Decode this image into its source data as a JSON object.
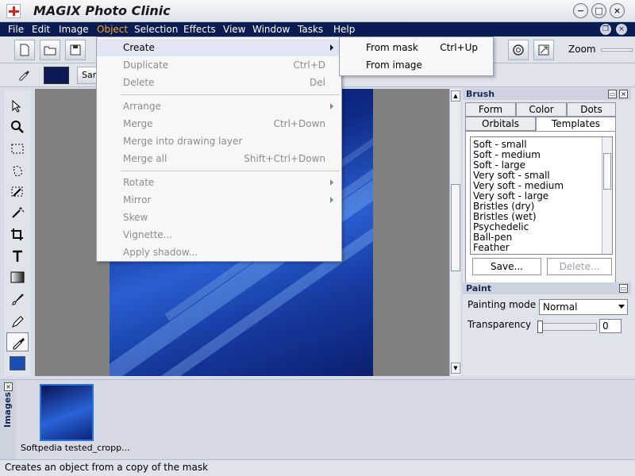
{
  "window": {
    "title": "MAGIX Photo Clinic",
    "min": "−",
    "max": "□",
    "close": "×"
  },
  "menubar": {
    "items": [
      "File",
      "Edit",
      "Image",
      "Object",
      "Selection",
      "Effects",
      "View",
      "Window",
      "Tasks",
      "Help"
    ],
    "active": "Object"
  },
  "toolbar": {
    "zoom_label": "Zoom",
    "sample_label": "Sam",
    "color": "#0d1a55"
  },
  "object_menu": {
    "items": [
      {
        "label": "Create",
        "shortcut": "",
        "submenu": true,
        "enabled": true
      },
      {
        "label": "Duplicate",
        "shortcut": "Ctrl+D",
        "submenu": false,
        "enabled": false
      },
      {
        "label": "Delete",
        "shortcut": "Del",
        "submenu": false,
        "enabled": false
      },
      {
        "label": "Arrange",
        "shortcut": "",
        "submenu": true,
        "enabled": false
      },
      {
        "label": "Merge",
        "shortcut": "Ctrl+Down",
        "submenu": false,
        "enabled": false
      },
      {
        "label": "Merge into drawing layer",
        "shortcut": "",
        "submenu": false,
        "enabled": false
      },
      {
        "label": "Merge all",
        "shortcut": "Shift+Ctrl+Down",
        "submenu": false,
        "enabled": false
      },
      {
        "label": "Rotate",
        "shortcut": "",
        "submenu": true,
        "enabled": false
      },
      {
        "label": "Mirror",
        "shortcut": "",
        "submenu": true,
        "enabled": false
      },
      {
        "label": "Skew",
        "shortcut": "",
        "submenu": false,
        "enabled": false
      },
      {
        "label": "Vignette...",
        "shortcut": "",
        "submenu": false,
        "enabled": false
      },
      {
        "label": "Apply shadow...",
        "shortcut": "",
        "submenu": false,
        "enabled": false
      }
    ]
  },
  "create_submenu": {
    "items": [
      {
        "label": "From mask",
        "shortcut": "Ctrl+Up"
      },
      {
        "label": "From image",
        "shortcut": ""
      }
    ]
  },
  "brush_panel": {
    "title": "Brush",
    "tabs_top": [
      "Form",
      "Color",
      "Dots"
    ],
    "tabs_bottom": [
      "Orbitals",
      "Templates"
    ],
    "active_tab": "Templates",
    "templates": [
      "Soft - small",
      "Soft - medium",
      "Soft - large",
      "Very soft - small",
      "Very soft - medium",
      "Very soft - large",
      "Bristles (dry)",
      "Bristles (wet)",
      "Psychedelic",
      "Ball-pen",
      "Feather"
    ],
    "save_label": "Save...",
    "delete_label": "Delete..."
  },
  "paint_panel": {
    "title": "Paint",
    "mode_label": "Painting mode",
    "mode_value": "Normal",
    "transparency_label": "Transparency",
    "transparency_value": "0"
  },
  "images_strip": {
    "label": "Images",
    "thumb_caption": "Softpedia tested_cropp..."
  },
  "status": {
    "text": "Creates an object from a copy of the mask"
  }
}
